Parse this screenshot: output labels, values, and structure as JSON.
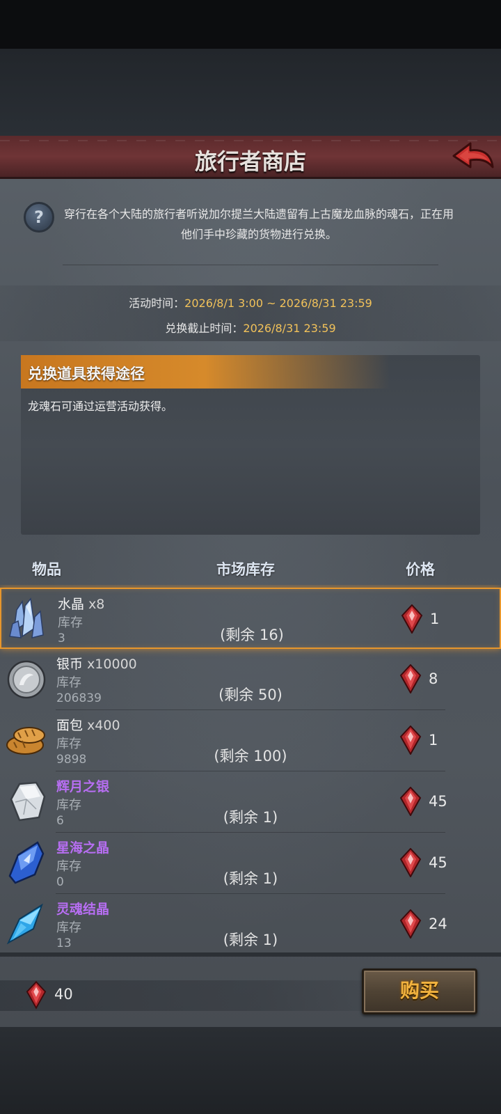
{
  "header": {
    "title": "旅行者商店"
  },
  "description": "穿行在各个大陆的旅行者听说加尔提兰大陆遗留有上古魔龙血脉的魂石，正在用他们手中珍藏的货物进行兑换。",
  "event": {
    "activity_label": "活动时间：",
    "activity_value": "2026/8/1 3:00 ~ 2026/8/31 23:59",
    "deadline_label": "兑换截止时间：",
    "deadline_value": "2026/8/31 23:59"
  },
  "exchange_info": {
    "title": "兑换道具获得途径",
    "text": "龙魂石可通过运营活动获得。"
  },
  "table": {
    "col_item": "物品",
    "col_stock": "市场库存",
    "col_price": "价格",
    "stock_label": "库存"
  },
  "items": [
    {
      "name": "水晶",
      "qty": "x8",
      "stock": "3",
      "remain": "(剩余 16)",
      "price": "1",
      "rarity": "normal",
      "icon": "crystal-icon"
    },
    {
      "name": "银币",
      "qty": "x10000",
      "stock": "206839",
      "remain": "(剩余 50)",
      "price": "8",
      "rarity": "normal",
      "icon": "silver-coin-icon"
    },
    {
      "name": "面包",
      "qty": "x400",
      "stock": "9898",
      "remain": "(剩余 100)",
      "price": "1",
      "rarity": "normal",
      "icon": "bread-icon"
    },
    {
      "name": "辉月之银",
      "qty": "",
      "stock": "6",
      "remain": "(剩余 1)",
      "price": "45",
      "rarity": "epic",
      "icon": "moon-silver-icon"
    },
    {
      "name": "星海之晶",
      "qty": "",
      "stock": "0",
      "remain": "(剩余 1)",
      "price": "45",
      "rarity": "epic",
      "icon": "star-sea-crystal-icon"
    },
    {
      "name": "灵魂结晶",
      "qty": "",
      "stock": "13",
      "remain": "(剩余 1)",
      "price": "24",
      "rarity": "epic",
      "icon": "soul-crystal-icon"
    }
  ],
  "footer": {
    "currency_count": "40",
    "buy_label": "购买"
  },
  "colors": {
    "accent_orange": "#e7962c",
    "epic_purple": "#b76ef2",
    "time_value": "#f2c25a",
    "buy_text": "#f1b23e"
  }
}
